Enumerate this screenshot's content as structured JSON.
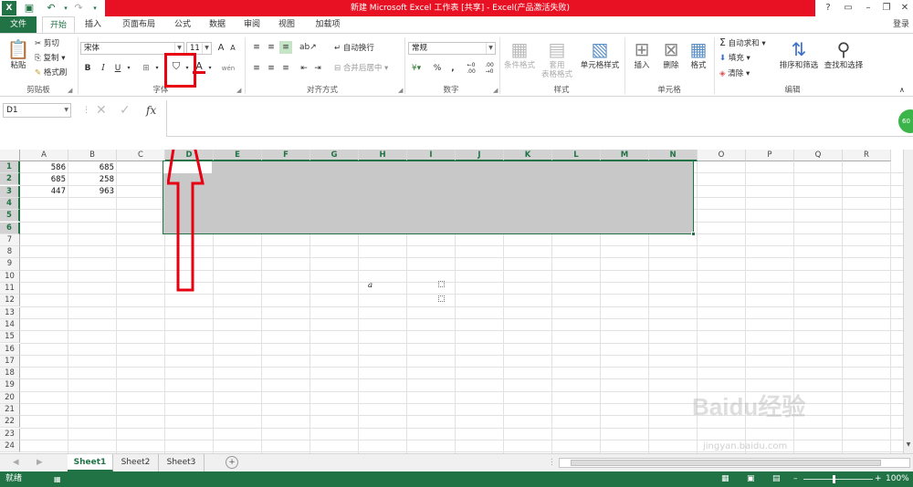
{
  "window": {
    "title": "新建 Microsoft Excel 工作表 [共享] - Excel(产品激活失败)",
    "controls": [
      "?",
      "▭",
      "–",
      "❐",
      "✕"
    ]
  },
  "ribbon_tabs": [
    "文件",
    "开始",
    "插入",
    "页面布局",
    "公式",
    "数据",
    "审阅",
    "视图",
    "加载项"
  ],
  "login": "登录",
  "clipboard": {
    "paste": "粘贴",
    "cut": "剪切",
    "copy": "复制",
    "format_painter": "格式刷",
    "label": "剪贴板"
  },
  "font": {
    "name": "宋体",
    "size": "11",
    "bold": "B",
    "italic": "I",
    "underline": "U",
    "label": "字体"
  },
  "alignment": {
    "wrap": "自动换行",
    "merge": "合并后居中",
    "label": "对齐方式"
  },
  "number": {
    "format": "常规",
    "percent": "%",
    "comma": ",",
    "label": "数字"
  },
  "styles": {
    "conditional": "条件格式",
    "table": "套用\n表格格式",
    "cell_styles": "单元格样式",
    "label": "样式"
  },
  "cells": {
    "insert": "插入",
    "delete": "删除",
    "format": "格式",
    "label": "单元格"
  },
  "editing": {
    "autosum": "自动求和",
    "fill": "填充",
    "clear": "清除",
    "sort": "排序和筛选",
    "find": "查找和选择",
    "label": "编辑"
  },
  "formula_bar": {
    "name_box": "D1",
    "fx": "fx",
    "content": ""
  },
  "columns": [
    "A",
    "B",
    "C",
    "D",
    "E",
    "F",
    "G",
    "H",
    "I",
    "J",
    "K",
    "L",
    "M",
    "N",
    "O",
    "P",
    "Q",
    "R"
  ],
  "rows": [
    "1",
    "2",
    "3",
    "4",
    "5",
    "6",
    "7",
    "8",
    "9",
    "10",
    "11",
    "12",
    "13",
    "14",
    "15",
    "16",
    "17",
    "18",
    "19",
    "20",
    "21",
    "22",
    "23",
    "24"
  ],
  "cells_data": [
    {
      "a": "586",
      "b": "685"
    },
    {
      "a": "685",
      "b": "258"
    },
    {
      "a": "447",
      "b": "963"
    }
  ],
  "floating_label": "a",
  "sheets": [
    "Sheet1",
    "Sheet2",
    "Sheet3"
  ],
  "add_sheet": "+",
  "status": {
    "ready": "就绪",
    "zoom": "100%",
    "zoom_minus": "–",
    "zoom_plus": "+"
  },
  "watermark": "Baidu经验",
  "watermark_url": "jingyan.baidu.com",
  "annotation_color": "#e60012",
  "accent": "#217346"
}
